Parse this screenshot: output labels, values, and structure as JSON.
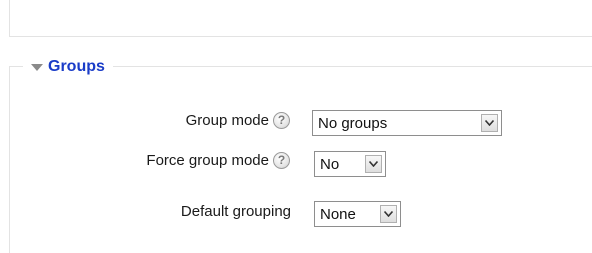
{
  "section": {
    "title": "Groups",
    "expanded": true,
    "icon": "triangle-down-icon"
  },
  "fields": {
    "group_mode": {
      "label": "Group mode",
      "help_icon": "help-question-icon",
      "help_glyph": "?",
      "value": "No groups"
    },
    "force_group_mode": {
      "label": "Force group mode",
      "help_icon": "help-question-icon",
      "help_glyph": "?",
      "value": "No"
    },
    "default_grouping": {
      "label": "Default grouping",
      "value": "None"
    }
  },
  "colors": {
    "legend_title": "#1a3cc8",
    "border": "#e3e3e3"
  }
}
